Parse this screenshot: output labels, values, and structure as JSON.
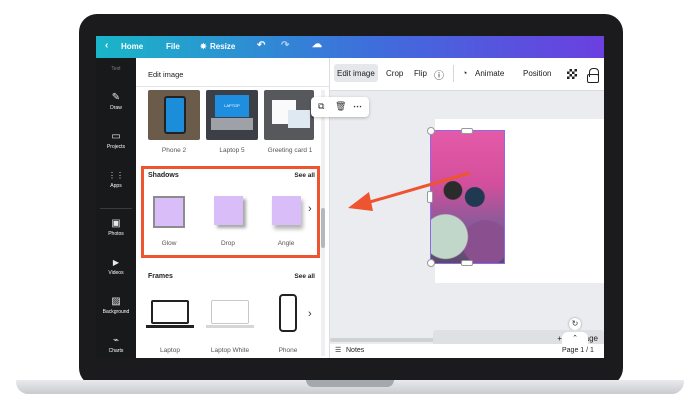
{
  "topbar": {
    "back": "‹",
    "home": "Home",
    "file": "File",
    "resize_icon": "✵",
    "resize": "Resize",
    "undo": "↶",
    "redo": "↷",
    "cloud": "☁"
  },
  "rail": {
    "text": "Text",
    "items": [
      {
        "label": "Draw",
        "icon": "✎"
      },
      {
        "label": "Projects",
        "icon": "▭"
      },
      {
        "label": "Apps",
        "icon": "⋮⋮"
      },
      {
        "label": "Photos",
        "icon": "▣"
      },
      {
        "label": "Videos",
        "icon": "▶"
      },
      {
        "label": "Background",
        "icon": "▨"
      },
      {
        "label": "Charts",
        "icon": "⌁"
      }
    ]
  },
  "panel": {
    "title": "Edit image",
    "mockups": [
      {
        "caption": "Phone 2"
      },
      {
        "caption": "Laptop 5"
      },
      {
        "caption": "Greeting card 1"
      }
    ],
    "mockup_laptop_text": "LAPTOP MOCKUP",
    "shadows": {
      "title": "Shadows",
      "see_all": "See all",
      "items": [
        {
          "caption": "Glow"
        },
        {
          "caption": "Drop"
        },
        {
          "caption": "Angle"
        }
      ]
    },
    "frames": {
      "title": "Frames",
      "see_all": "See all",
      "items": [
        {
          "caption": "Laptop"
        },
        {
          "caption": "Laptop White"
        },
        {
          "caption": "Phone"
        }
      ]
    },
    "next_arrow": "›"
  },
  "toolbar": {
    "edit_image": "Edit image",
    "crop": "Crop",
    "flip": "Flip",
    "info": "ⓘ",
    "animate": "Animate",
    "position": "Position"
  },
  "canvas": {
    "add_page": "+ Add page",
    "notes": "Notes",
    "page_indicator": "Page 1 / 1",
    "rotate_icon": "↻",
    "collapse_icon": "⌃"
  },
  "colors": {
    "accent_red": "#ef5430",
    "shadow_tile": "#d9bdf9",
    "rail_bg": "#18191b"
  }
}
